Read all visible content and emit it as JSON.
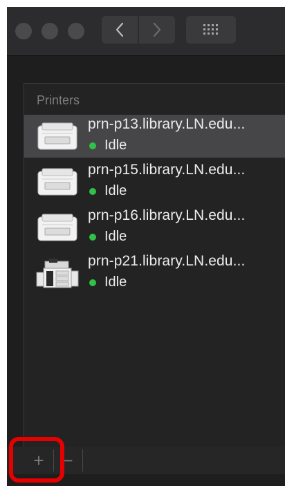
{
  "titlebar": {
    "back_icon": "chevron-left-icon",
    "forward_icon": "chevron-right-icon",
    "grid_icon": "grid-icon"
  },
  "printers": {
    "header": "Printers",
    "items": [
      {
        "name": "prn-p13.library.LN.edu...",
        "status": "Idle",
        "icon": "laser-printer-icon",
        "selected": true
      },
      {
        "name": "prn-p15.library.LN.edu...",
        "status": "Idle",
        "icon": "laser-printer-icon",
        "selected": false
      },
      {
        "name": "prn-p16.library.LN.edu...",
        "status": "Idle",
        "icon": "laser-printer-icon",
        "selected": false
      },
      {
        "name": "prn-p21.library.LN.edu...",
        "status": "Idle",
        "icon": "copier-printer-icon",
        "selected": false
      }
    ]
  },
  "toolbar": {
    "add_label": "+",
    "remove_label": "−"
  },
  "colors": {
    "status_idle": "#30c247",
    "highlight": "#e60000",
    "selection": "#464648"
  }
}
